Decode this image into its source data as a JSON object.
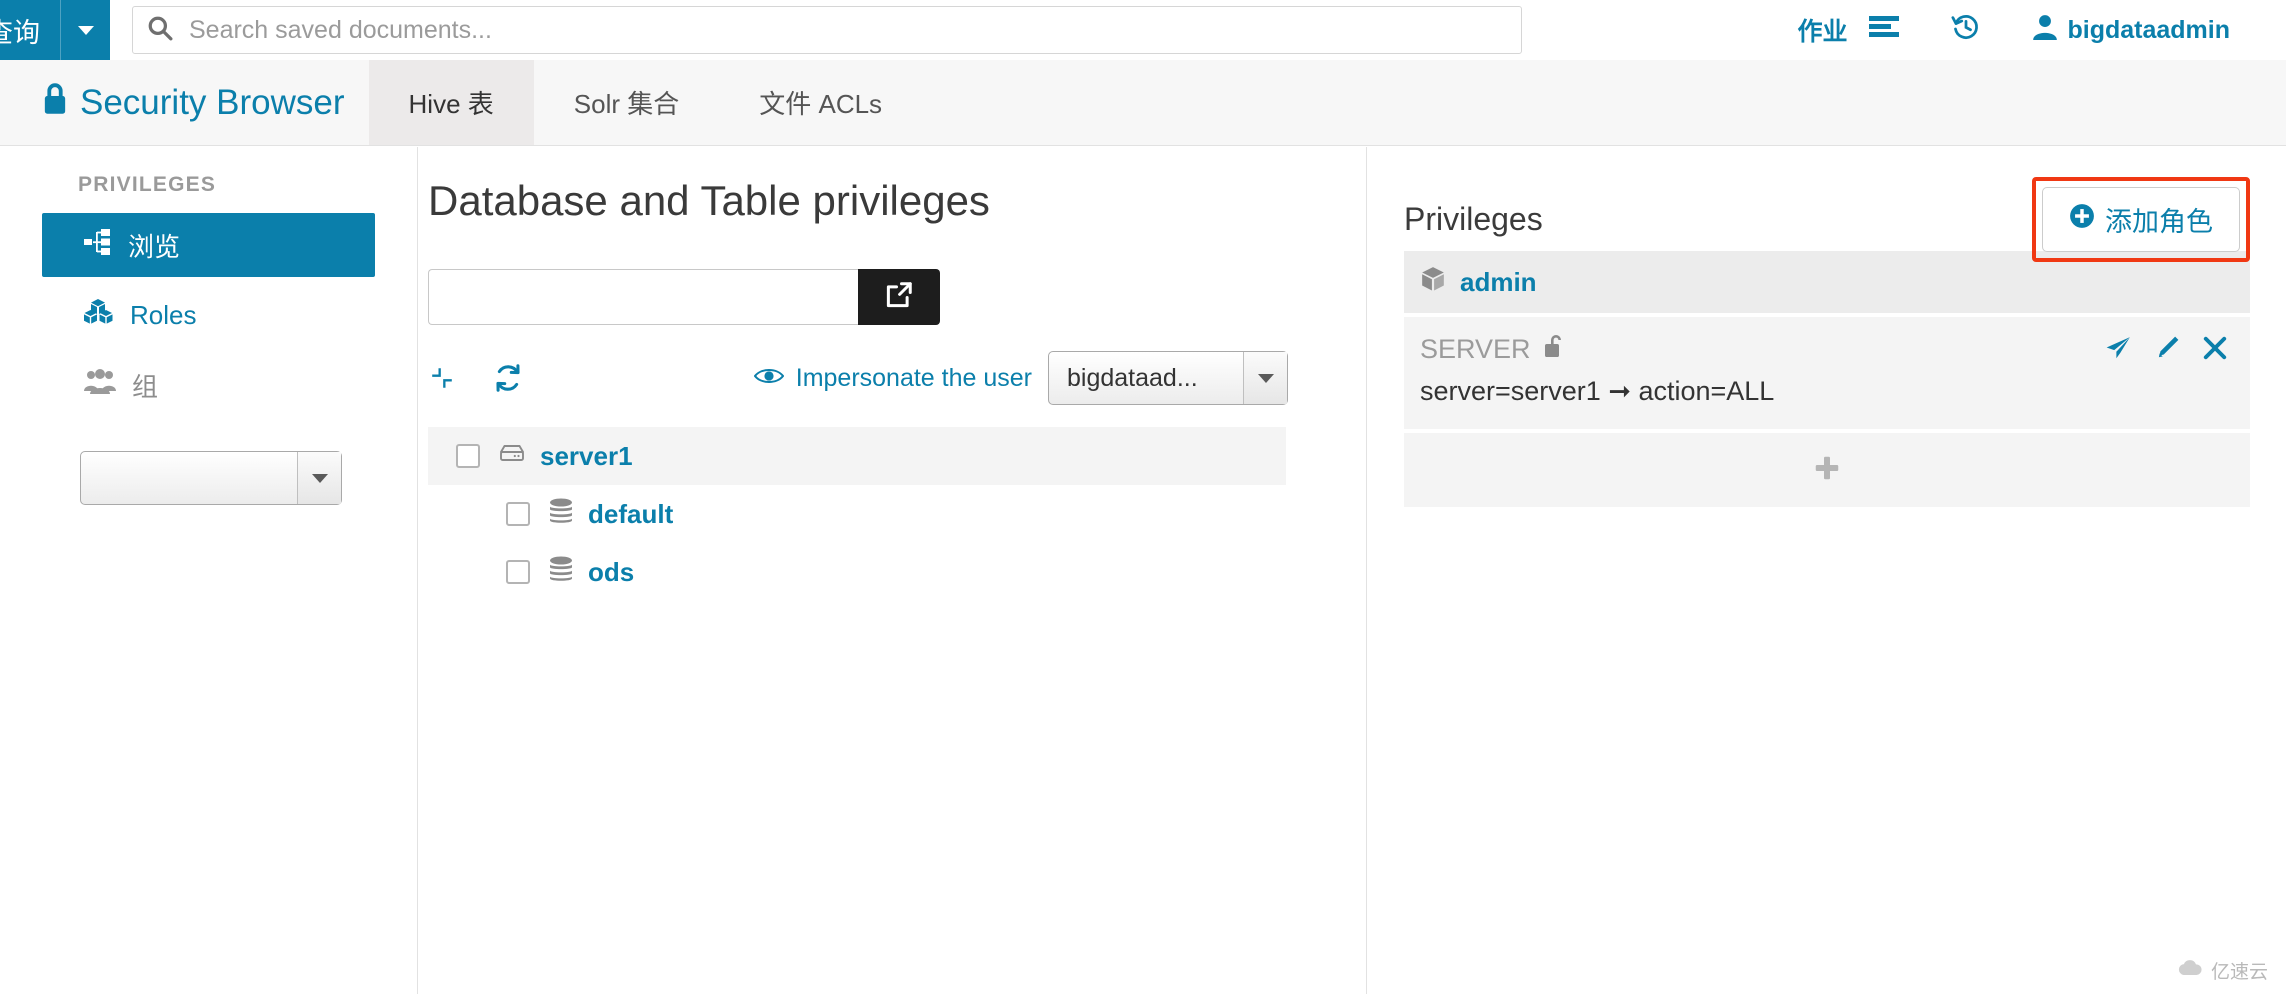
{
  "header": {
    "app_menu_label": "查询",
    "app_menu_icon": "caret-down-icon",
    "search_placeholder": "Search saved documents...",
    "search_value": "",
    "search_icon": "search-icon",
    "jobs_label": "作业",
    "jobs_icon": "list-icon",
    "history_icon": "history-icon",
    "user_icon": "user-icon",
    "user_name": "bigdataadmin"
  },
  "appbar": {
    "brand_icon": "lock-icon",
    "brand_title": "Security Browser",
    "tabs": [
      {
        "label": "Hive 表",
        "active": true
      },
      {
        "label": "Solr 集合",
        "active": false
      },
      {
        "label": "文件 ACLs",
        "active": false
      }
    ]
  },
  "sidebar": {
    "section_label": "PRIVILEGES",
    "items": [
      {
        "label": "浏览",
        "icon": "sitemap-icon",
        "active": true
      },
      {
        "label": "Roles",
        "icon": "cubes-icon",
        "active": false
      },
      {
        "label": "组",
        "icon": "users-icon",
        "active": false,
        "muted": true
      }
    ],
    "group_select_value": "",
    "group_select_icon": "caret-down-icon"
  },
  "main": {
    "page_title": "Database and Table privileges",
    "filter_value": "",
    "filter_placeholder": "",
    "go_button_icon": "external-link-icon",
    "collapse_icon": "compress-icon",
    "refresh_icon": "refresh-icon",
    "impersonate_icon": "eye-icon",
    "impersonate_label": "Impersonate the user",
    "impersonate_value": "bigdataad...",
    "impersonate_caret": "caret-down-icon",
    "tree": [
      {
        "label": "server1",
        "icon": "server-icon",
        "level": 0,
        "checked": false,
        "selected": true
      },
      {
        "label": "default",
        "icon": "database-icon",
        "level": 1,
        "checked": false,
        "selected": false
      },
      {
        "label": "ods",
        "icon": "database-icon",
        "level": 1,
        "checked": false,
        "selected": false
      }
    ]
  },
  "privileges_panel": {
    "title": "Privileges",
    "add_role_label": "添加角色",
    "add_role_icon": "plus-circle-icon",
    "add_role_highlighted": true,
    "highlight_color": "#f03813",
    "role": {
      "name": "admin",
      "icon": "cube-icon"
    },
    "privilege": {
      "scope_label": "SERVER",
      "scope_icon": "unlock-icon",
      "rule": "server=server1 ➞ action=ALL",
      "actions": [
        {
          "name": "share",
          "icon": "paper-plane-icon"
        },
        {
          "name": "edit",
          "icon": "pencil-icon"
        },
        {
          "name": "delete",
          "icon": "times-icon"
        }
      ]
    },
    "add_privilege_icon": "plus-icon"
  },
  "watermark": {
    "text": "亿速云",
    "icon": "cloud-icon"
  },
  "colors": {
    "brand_blue": "#0b7fab",
    "link_blue": "#0b7fab",
    "highlight_red": "#f03813",
    "dark_button": "#1d1d1d"
  }
}
